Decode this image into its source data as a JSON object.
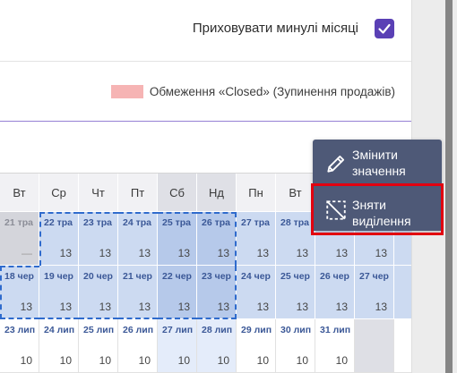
{
  "colors": {
    "accent_purple": "#5a40b5",
    "closed_swatch": "#f6b4b4",
    "selection_outline": "#2f6bcd",
    "menu_background": "#4e5977",
    "highlight_red": "#e2000f",
    "selected_cell": "#ccdaf1",
    "selected_weekend_cell": "#b6c9ea",
    "weekend_cell": "#e4ecfa",
    "past_cell": "#d4d5db",
    "empty_cell": "#dedfe5"
  },
  "settings": {
    "hide_past_months": {
      "label": "Приховувати минулі місяці",
      "checked": true
    }
  },
  "legend": {
    "closed": {
      "label": "Обмеження «Closed» (Зупинення продажів)"
    }
  },
  "calendar": {
    "weekdays": [
      {
        "label": "Вт"
      },
      {
        "label": "Ср"
      },
      {
        "label": "Чт"
      },
      {
        "label": "Пт"
      },
      {
        "label": "Сб",
        "weekend": true
      },
      {
        "label": "Нд",
        "weekend": true
      },
      {
        "label": "Пн"
      },
      {
        "label": "Вт"
      }
    ],
    "rows": [
      {
        "cells": [
          {
            "date": "21 тра",
            "value": "—",
            "state": "past"
          },
          {
            "date": "22 тра",
            "value": "13",
            "state": "selected",
            "outlined": true
          },
          {
            "date": "23 тра",
            "value": "13",
            "state": "selected",
            "outlined": true
          },
          {
            "date": "24 тра",
            "value": "13",
            "state": "selected",
            "outlined": true
          },
          {
            "date": "25 тра",
            "value": "13",
            "state": "selected",
            "outlined": true
          },
          {
            "date": "26 тра",
            "value": "13",
            "state": "selected",
            "outlined": true
          },
          {
            "date": "27 тра",
            "value": "13",
            "state": "selected"
          },
          {
            "date": "28 тра",
            "value": "13",
            "state": "selected"
          },
          {
            "value": "13",
            "state": "selected"
          },
          {
            "value": "13",
            "state": "selected"
          },
          {
            "state": "selected"
          }
        ]
      },
      {
        "cells": [
          {
            "date": "18 чер",
            "value": "13",
            "state": "selected",
            "outlined": true
          },
          {
            "date": "19 чер",
            "value": "13",
            "state": "selected",
            "outlined": true
          },
          {
            "date": "20 чер",
            "value": "13",
            "state": "selected",
            "outlined": true
          },
          {
            "date": "21 чер",
            "value": "13",
            "state": "selected",
            "outlined": true
          },
          {
            "date": "22 чер",
            "value": "13",
            "state": "selected",
            "outlined": true
          },
          {
            "date": "23 чер",
            "value": "13",
            "state": "selected",
            "outlined": true
          },
          {
            "date": "24 чер",
            "value": "13",
            "state": "selected"
          },
          {
            "date": "25 чер",
            "value": "13",
            "state": "selected"
          },
          {
            "date": "26 чер",
            "value": "13",
            "state": "selected"
          },
          {
            "date": "27 чер",
            "value": "13",
            "state": "selected"
          },
          {
            "state": "selected"
          }
        ]
      },
      {
        "cells": [
          {
            "date": "23 лип",
            "value": "10",
            "state": "default"
          },
          {
            "date": "24 лип",
            "value": "10",
            "state": "default"
          },
          {
            "date": "25 лип",
            "value": "10",
            "state": "default"
          },
          {
            "date": "26 лип",
            "value": "10",
            "state": "default"
          },
          {
            "date": "27 лип",
            "value": "10",
            "state": "default"
          },
          {
            "date": "28 лип",
            "value": "10",
            "state": "default"
          },
          {
            "date": "29 лип",
            "value": "10",
            "state": "default"
          },
          {
            "date": "30 лип",
            "value": "10",
            "state": "default"
          },
          {
            "date": "31 лип",
            "value": "10",
            "state": "default"
          },
          {
            "state": "empty"
          },
          {
            "state": "default"
          }
        ]
      }
    ]
  },
  "context_menu": {
    "items": [
      {
        "label": "Змінити значення",
        "icon": "pencil-icon"
      },
      {
        "label": "Зняти виділення",
        "icon": "deselect-icon",
        "highlighted": true
      }
    ]
  }
}
